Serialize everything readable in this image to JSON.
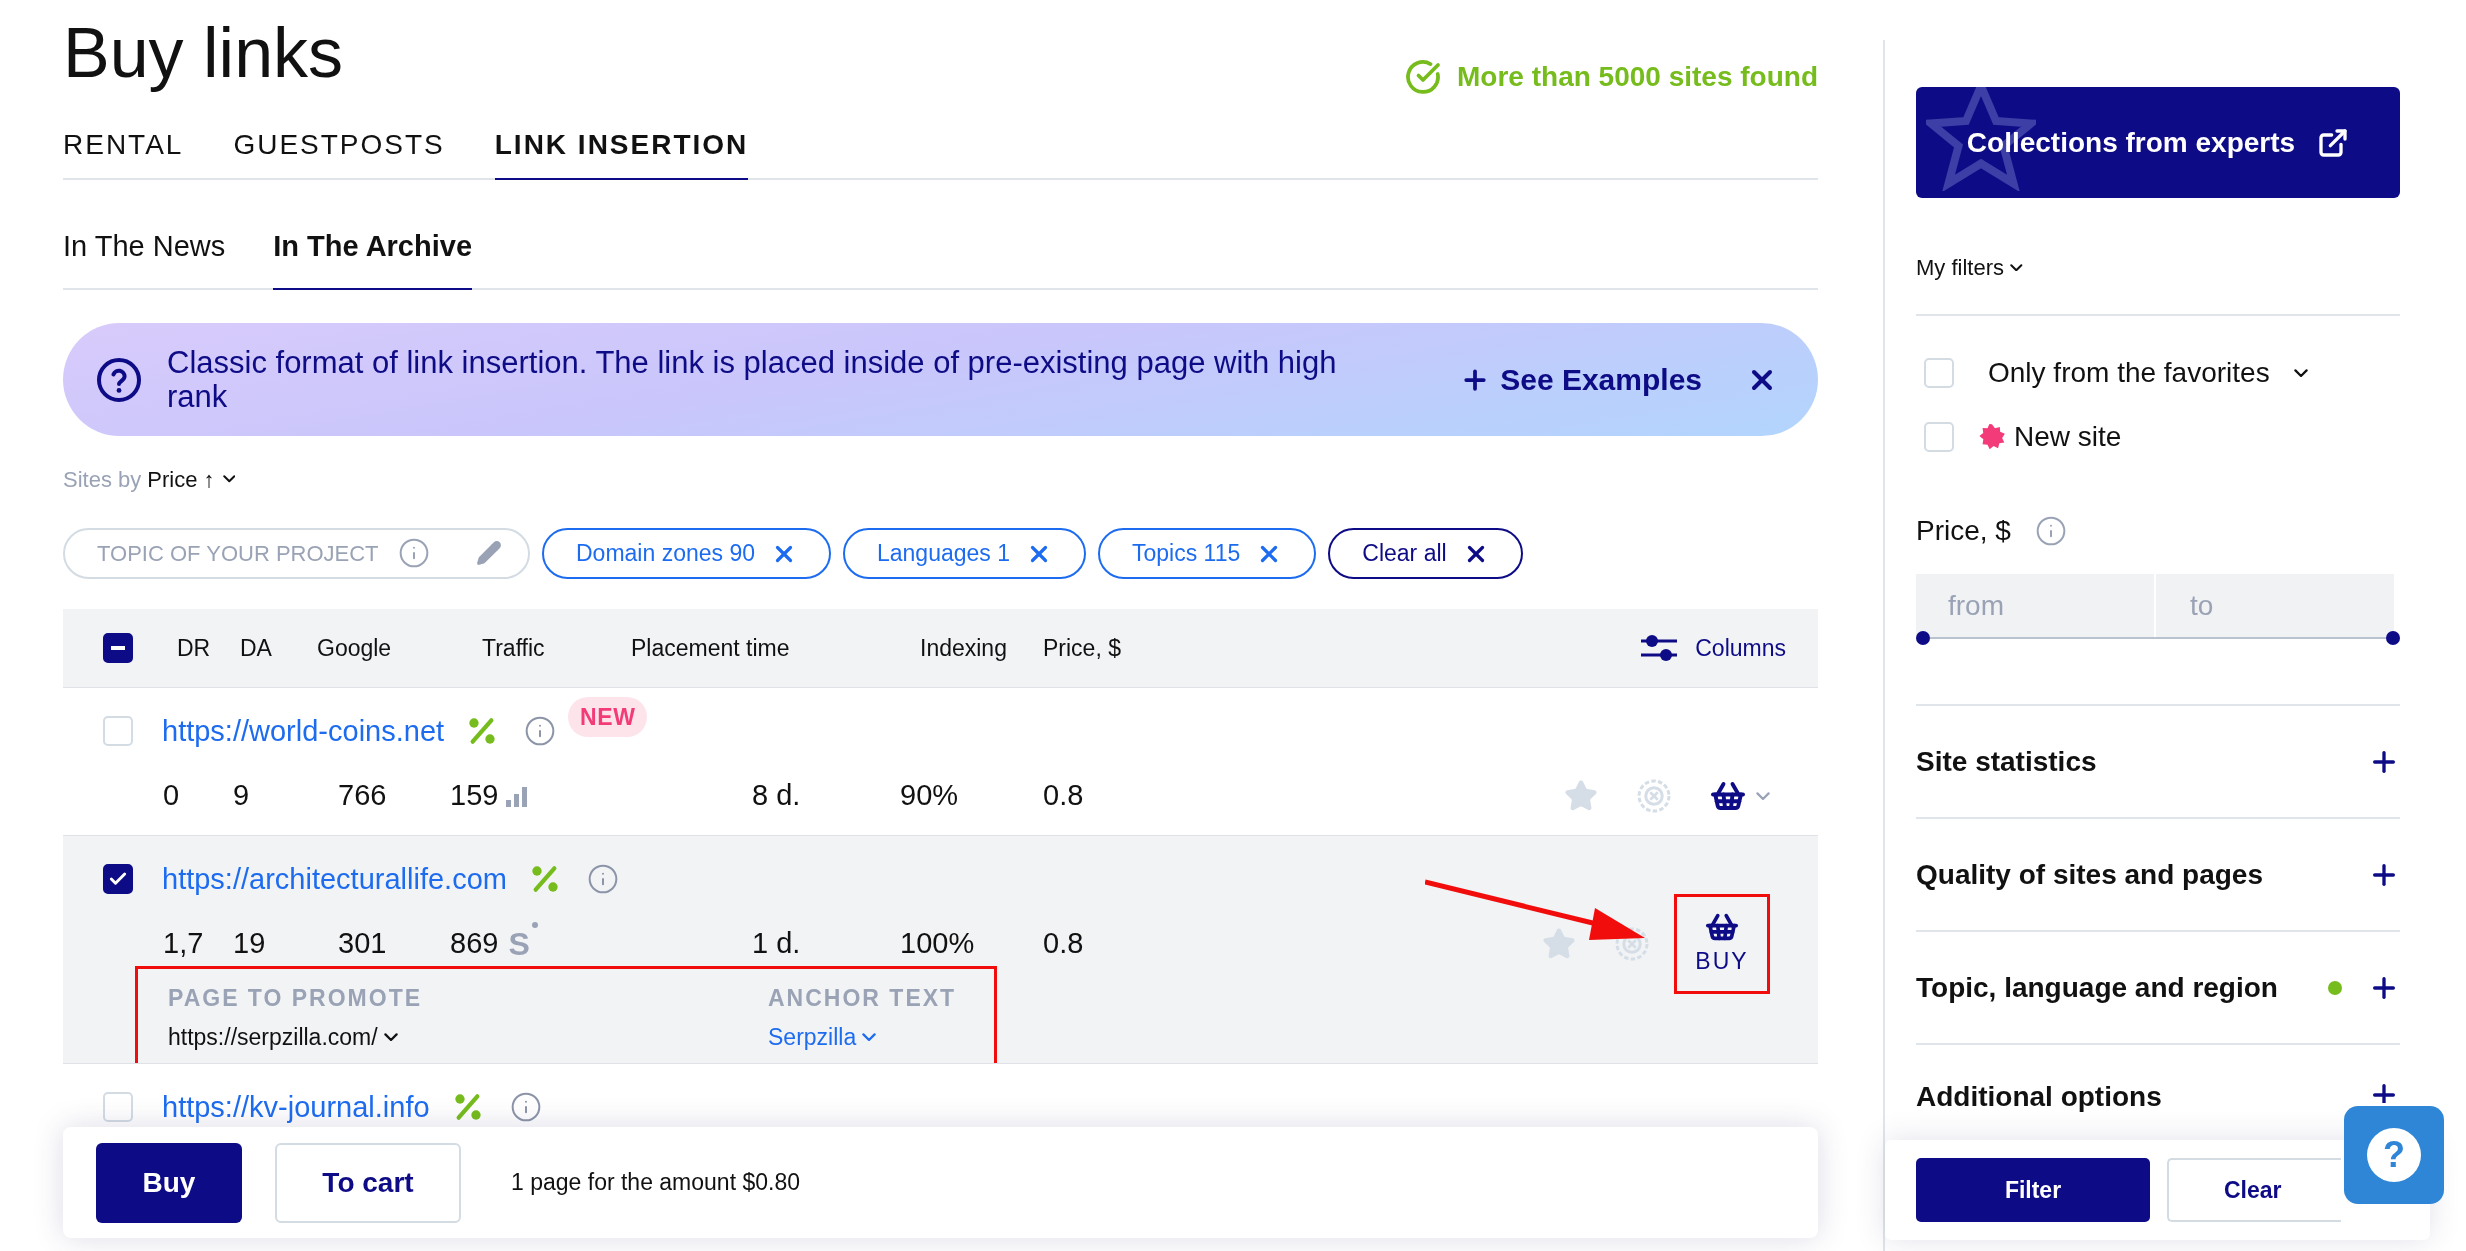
{
  "page_title": "Buy links",
  "found_notice": "More than 5000 sites found",
  "tabs": [
    {
      "label": "RENTAL",
      "selected": false
    },
    {
      "label": "GUESTPOSTS",
      "selected": false
    },
    {
      "label": "LINK INSERTION",
      "selected": true
    }
  ],
  "subtabs": [
    {
      "label": "In The News",
      "selected": false
    },
    {
      "label": "In The Archive",
      "selected": true
    }
  ],
  "banner": {
    "text": "Classic format of link insertion. The link is placed inside of pre-existing page with high rank",
    "action": "See Examples"
  },
  "sort": {
    "prefix": "Sites by",
    "value": "Price ↑"
  },
  "project_field": {
    "placeholder": "TOPIC OF YOUR PROJECT"
  },
  "chips": [
    {
      "label": "Domain zones 90",
      "kind": "filter"
    },
    {
      "label": "Languages 1",
      "kind": "filter"
    },
    {
      "label": "Topics 115",
      "kind": "filter"
    },
    {
      "label": "Clear all",
      "kind": "clear"
    }
  ],
  "table": {
    "select_all": {
      "indeterminate": true
    },
    "columns": [
      "DR",
      "DA",
      "Google",
      "Traffic",
      "Placement time",
      "Indexing",
      "Price, $"
    ],
    "columns_button": "Columns",
    "rows": [
      {
        "url": "https://world-coins.net",
        "checked": false,
        "badge": "NEW",
        "values": [
          "0",
          "9",
          "766",
          "159",
          "8 d.",
          "90%",
          "0.8"
        ],
        "traffic_icon": {
          "kind": "bars"
        },
        "buy": {
          "kind": "icon",
          "highlighted": false
        }
      },
      {
        "url": "https://architecturallife.com",
        "checked": true,
        "values": [
          "1,7",
          "19",
          "301",
          "869",
          "1 d.",
          "100%",
          "0.8"
        ],
        "traffic_icon": {
          "kind": "letter",
          "text": "S"
        },
        "buy": {
          "kind": "labeled",
          "label": "BUY",
          "highlighted": true
        },
        "promote": {
          "highlighted": true,
          "page_label": "PAGE TO PROMOTE",
          "page_value": "https://serpzilla.com/",
          "anchor_label": "ANCHOR TEXT",
          "anchor_value": "Serpzilla"
        }
      },
      {
        "url": "https://kv-journal.info",
        "checked": false
      }
    ]
  },
  "bottom_bar": {
    "buy": "Buy",
    "to_cart": "To cart",
    "summary": "1 page for the amount $0.80"
  },
  "sidebar": {
    "collections_button": "Collections from experts",
    "my_filters": "My filters",
    "options": [
      {
        "label": "Only from the favorites",
        "checked": false,
        "kind": "dropdown"
      },
      {
        "label": "New site",
        "checked": false,
        "kind": "new"
      }
    ],
    "price": {
      "label": "Price, $",
      "from_placeholder": "from",
      "to_placeholder": "to",
      "slider": {
        "level": 1
      }
    },
    "sections": [
      {
        "title": "Site statistics",
        "expanded": false,
        "active": false
      },
      {
        "title": "Quality of sites and pages",
        "expanded": false,
        "active": false
      },
      {
        "title": "Topic, language and region",
        "expanded": false,
        "active": true
      },
      {
        "title": "Additional options",
        "expanded": false,
        "active": false
      }
    ],
    "filter_button": "Filter",
    "clear_button": "Clear"
  },
  "help": {
    "label": "?"
  }
}
